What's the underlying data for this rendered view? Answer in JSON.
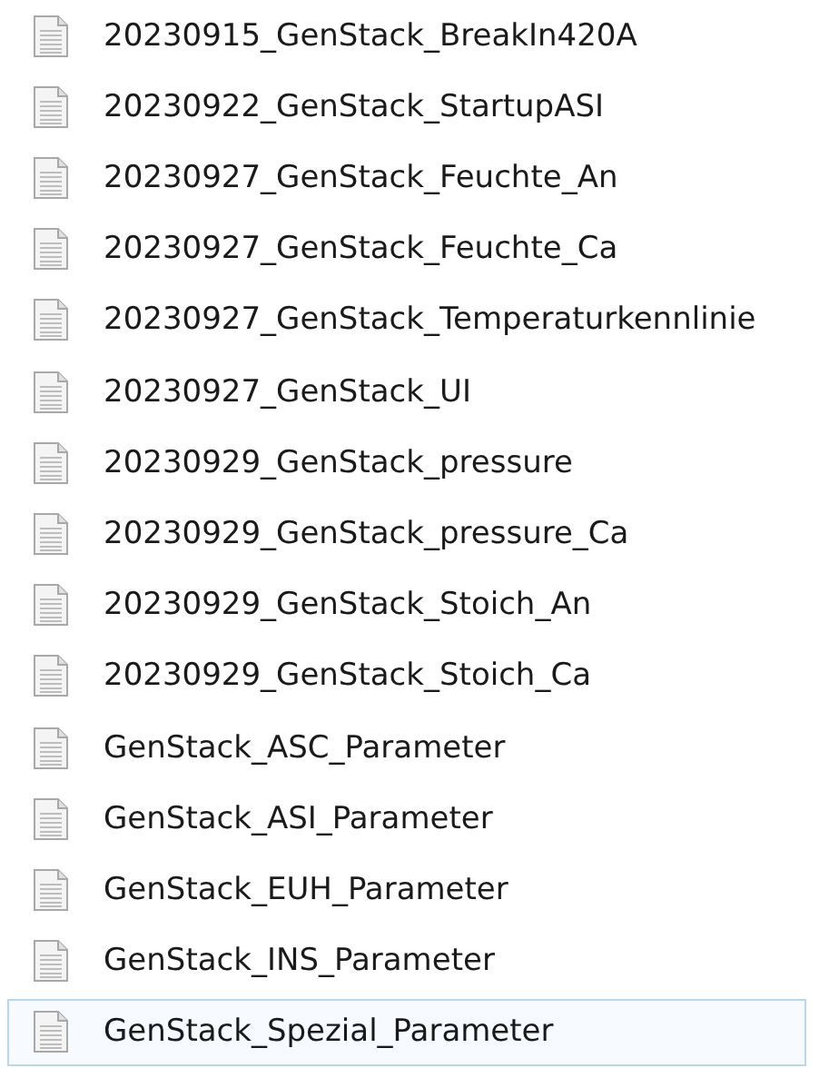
{
  "files": [
    {
      "name": "20230915_GenStack_BreakIn420A",
      "selected": false
    },
    {
      "name": "20230922_GenStack_StartupASI",
      "selected": false
    },
    {
      "name": "20230927_GenStack_Feuchte_An",
      "selected": false
    },
    {
      "name": "20230927_GenStack_Feuchte_Ca",
      "selected": false
    },
    {
      "name": "20230927_GenStack_Temperaturkennlinie",
      "selected": false
    },
    {
      "name": "20230927_GenStack_UI",
      "selected": false
    },
    {
      "name": "20230929_GenStack_pressure",
      "selected": false
    },
    {
      "name": "20230929_GenStack_pressure_Ca",
      "selected": false
    },
    {
      "name": "20230929_GenStack_Stoich_An",
      "selected": false
    },
    {
      "name": "20230929_GenStack_Stoich_Ca",
      "selected": false
    },
    {
      "name": "GenStack_ASC_Parameter",
      "selected": false
    },
    {
      "name": "GenStack_ASI_Parameter",
      "selected": false
    },
    {
      "name": "GenStack_EUH_Parameter",
      "selected": false
    },
    {
      "name": "GenStack_INS_Parameter",
      "selected": false
    },
    {
      "name": "GenStack_Spezial_Parameter",
      "selected": true
    }
  ]
}
